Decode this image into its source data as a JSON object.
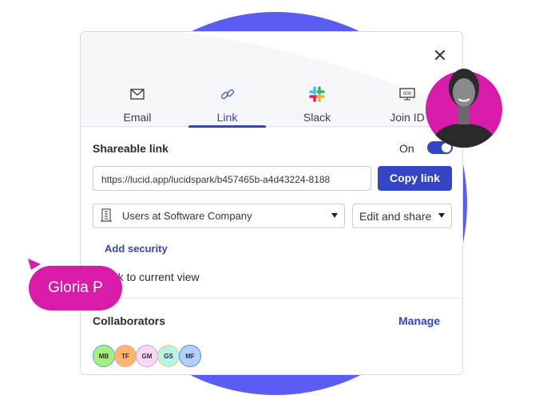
{
  "tabs": [
    {
      "label": "Email",
      "icon": "envelope-icon"
    },
    {
      "label": "Link",
      "icon": "link-icon",
      "active": true
    },
    {
      "label": "Slack",
      "icon": "slack-icon"
    },
    {
      "label": "Join ID",
      "icon": "join-id-icon"
    }
  ],
  "shareable": {
    "title": "Shareable link",
    "toggle_label": "On",
    "toggle_on": true
  },
  "link_url": "https://lucid.app/lucidspark/b457465b-a4d43224-8188",
  "copy_label": "Copy link",
  "access_select": "Users at Software Company",
  "permission_select": "Edit and share",
  "add_security": "Add security",
  "current_view": "Link to current view",
  "collaborators": {
    "title": "Collaborators",
    "manage": "Manage",
    "avatars": [
      {
        "initials": "MB",
        "bg": "#a6ef7c",
        "border": "#5aa8e0"
      },
      {
        "initials": "TF",
        "bg": "#ffb66b",
        "border": "#f39ac8"
      },
      {
        "initials": "GM",
        "bg": "#ffd6f3",
        "border": "#9ab8f0"
      },
      {
        "initials": "GS",
        "bg": "#b6f3e6",
        "border": "#f2d35a"
      },
      {
        "initials": "MF",
        "bg": "#b3d1ff",
        "border": "#5a86d8"
      }
    ]
  },
  "cursor_badge": "Gloria P",
  "colors": {
    "accent": "#3344c4",
    "brand_pink": "#d81ba8",
    "background_circle": "#5b5cf2"
  }
}
